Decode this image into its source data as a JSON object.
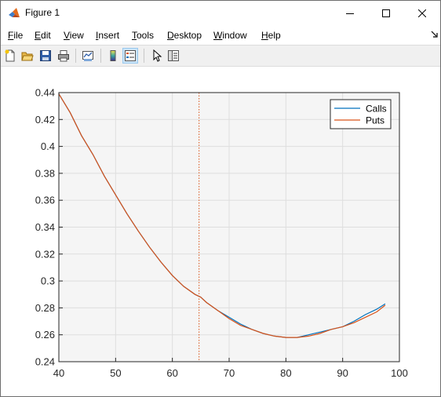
{
  "window": {
    "title": "Figure 1"
  },
  "menu": [
    {
      "label": "File",
      "key": "F",
      "rest": "ile"
    },
    {
      "label": "Edit",
      "key": "E",
      "rest": "dit"
    },
    {
      "label": "View",
      "key": "V",
      "rest": "iew"
    },
    {
      "label": "Insert",
      "key": "I",
      "rest": "nsert"
    },
    {
      "label": "Tools",
      "key": "T",
      "rest": "ools"
    },
    {
      "label": "Desktop",
      "key": "D",
      "rest": "esktop"
    },
    {
      "label": "Window",
      "key": "W",
      "rest": "indow"
    },
    {
      "label": "Help",
      "key": "H",
      "rest": "elp"
    }
  ],
  "toolbar": {
    "icons": [
      "new-figure-icon",
      "open-file-icon",
      "save-icon",
      "print-icon",
      "link-plot-icon",
      "colorbar-icon",
      "legend-icon",
      "edit-plot-icon",
      "property-inspector-icon"
    ]
  },
  "colors": {
    "calls": "#0072bd",
    "puts": "#d95319",
    "axes_bg": "#f5f5f5",
    "vline": "#d95319"
  },
  "chart_data": {
    "type": "line",
    "title": "",
    "xlabel": "",
    "ylabel": "",
    "xlim": [
      40,
      100
    ],
    "ylim": [
      0.24,
      0.44
    ],
    "xticks": [
      "40",
      "50",
      "60",
      "70",
      "80",
      "90",
      "100"
    ],
    "yticks": [
      "0.24",
      "0.26",
      "0.28",
      "0.3",
      "0.32",
      "0.34",
      "0.36",
      "0.38",
      "0.4",
      "0.42",
      "0.44"
    ],
    "grid": true,
    "legend_position": "top-right",
    "reference_line_x": 64.7,
    "series": [
      {
        "name": "Calls",
        "x": [
          40,
          42,
          44,
          46,
          48,
          50,
          52,
          54,
          56,
          58,
          60,
          62,
          64,
          65,
          66,
          68,
          70,
          72,
          74,
          76,
          78,
          80,
          82,
          84,
          86,
          88,
          90,
          92,
          94,
          96,
          97.5
        ],
        "y": [
          0.439,
          0.425,
          0.408,
          0.394,
          0.378,
          0.364,
          0.35,
          0.337,
          0.325,
          0.314,
          0.304,
          0.296,
          0.29,
          0.288,
          0.284,
          0.278,
          0.273,
          0.268,
          0.264,
          0.261,
          0.259,
          0.258,
          0.258,
          0.26,
          0.262,
          0.264,
          0.266,
          0.27,
          0.275,
          0.279,
          0.283
        ]
      },
      {
        "name": "Puts",
        "x": [
          40,
          42,
          44,
          46,
          48,
          50,
          52,
          54,
          56,
          58,
          60,
          62,
          64,
          65,
          66,
          68,
          70,
          72,
          74,
          76,
          78,
          80,
          82,
          84,
          86,
          88,
          90,
          92,
          94,
          96,
          97.5
        ],
        "y": [
          0.439,
          0.425,
          0.408,
          0.394,
          0.378,
          0.364,
          0.35,
          0.337,
          0.325,
          0.314,
          0.304,
          0.296,
          0.29,
          0.288,
          0.284,
          0.278,
          0.272,
          0.267,
          0.264,
          0.261,
          0.259,
          0.258,
          0.258,
          0.259,
          0.261,
          0.264,
          0.266,
          0.269,
          0.273,
          0.277,
          0.282
        ]
      }
    ]
  }
}
